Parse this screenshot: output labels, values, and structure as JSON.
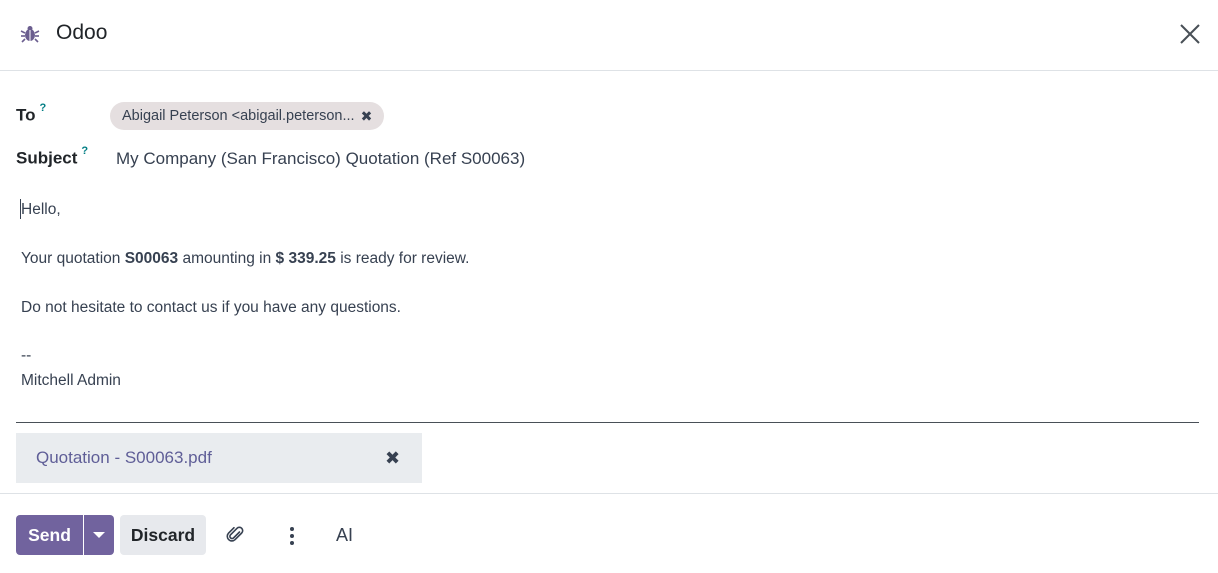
{
  "header": {
    "title": "Odoo",
    "icon": "bug-icon",
    "close_icon": "close-icon"
  },
  "fields": {
    "to_label": "To",
    "subject_label": "Subject",
    "help_mark": "?",
    "recipient_tag": "Abigail Peterson <abigail.peterson...",
    "remove_tag_glyph": "✖",
    "subject_value": "My Company (San Francisco) Quotation (Ref S00063)"
  },
  "body": {
    "greeting": "Hello,",
    "line1_prefix": "Your quotation ",
    "quote_ref": "S00063",
    "line1_mid": " amounting in ",
    "amount": "$ 339.25",
    "line1_suffix": " is ready for review.",
    "line2": "Do not hesitate to contact us if you have any questions.",
    "signature_sep": "--",
    "signature_name": "Mitchell Admin"
  },
  "attachment": {
    "name": "Quotation - S00063.pdf",
    "remove_glyph": "✖"
  },
  "footer": {
    "send_label": "Send",
    "discard_label": "Discard",
    "ai_label": "AI",
    "attach_icon": "paperclip-icon",
    "more_icon": "kebab-icon"
  },
  "colors": {
    "primary": "#71639e",
    "tag_bg": "#e5dfe0",
    "attachment_text": "#5f5e97",
    "help_mark": "#017e84"
  }
}
